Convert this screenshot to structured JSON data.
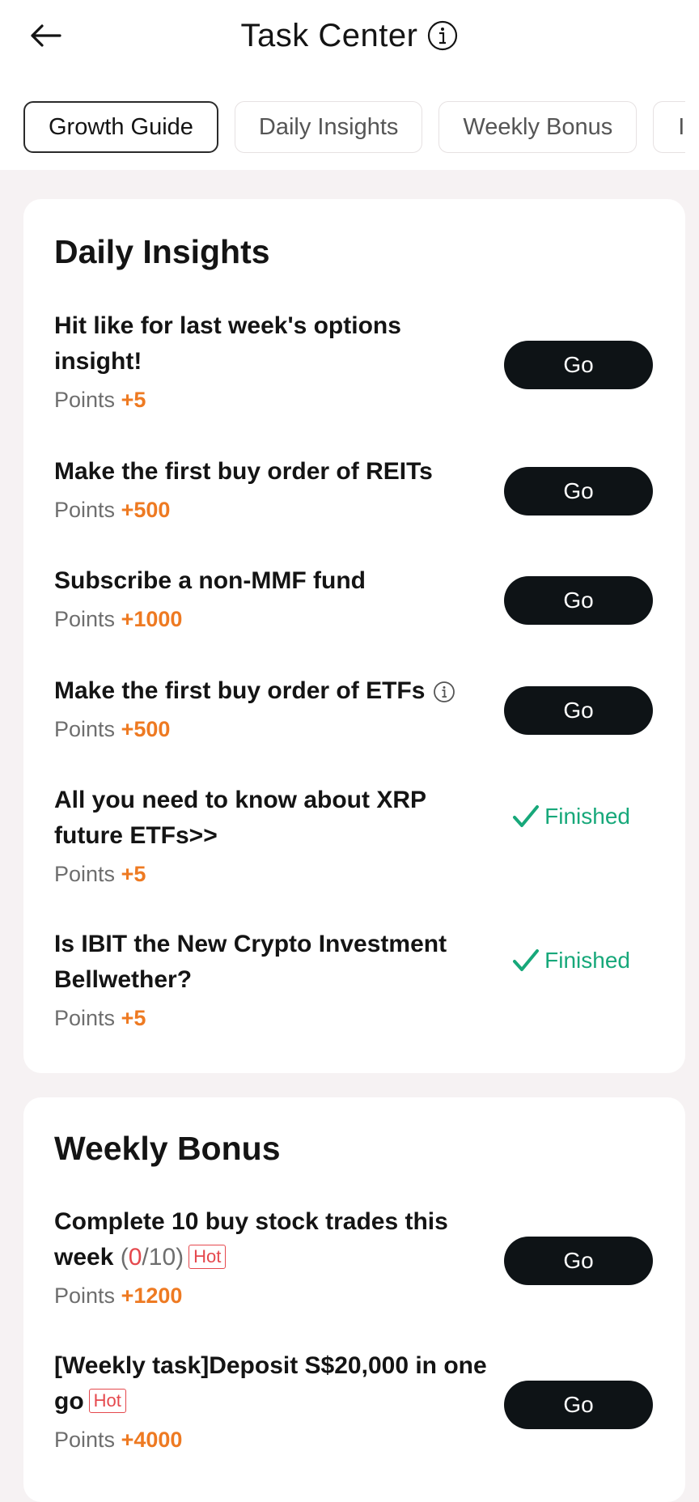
{
  "header": {
    "title": "Task Center"
  },
  "tabs": [
    "Growth Guide",
    "Daily Insights",
    "Weekly Bonus",
    "I"
  ],
  "daily": {
    "title": "Daily Insights",
    "tasks": [
      {
        "title": "Hit like for last week's options insight!",
        "points_label": "Points",
        "points": "+5",
        "action": "Go"
      },
      {
        "title": "Make the first buy order of REITs",
        "points_label": "Points",
        "points": "+500",
        "action": "Go"
      },
      {
        "title": "Subscribe a non-MMF fund",
        "points_label": "Points",
        "points": "+1000",
        "action": "Go"
      },
      {
        "title": "Make the first buy order of ETFs",
        "points_label": "Points",
        "points": "+500",
        "action": "Go"
      },
      {
        "title": "All you need to know about XRP future ETFs>>",
        "points_label": "Points",
        "points": "+5",
        "status": "Finished"
      },
      {
        "title": "Is IBIT the New Crypto Investment Bellwether?",
        "points_label": "Points",
        "points": "+5",
        "status": "Finished"
      }
    ]
  },
  "weekly": {
    "title": "Weekly Bonus",
    "tasks": [
      {
        "title": "Complete 10 buy stock trades this week",
        "progress_open": "(",
        "progress_current": "0",
        "progress_total": "/10)",
        "badge": "Hot",
        "points_label": "Points",
        "points": "+1200",
        "action": "Go"
      },
      {
        "title": "[Weekly task]Deposit S$20,000 in one go",
        "badge": "Hot",
        "points_label": "Points",
        "points": "+4000",
        "action": "Go"
      }
    ]
  },
  "colors": {
    "accent_points": "#ee7a22",
    "finished": "#17a87a",
    "hot": "#e5484d",
    "button": "#0e1316"
  }
}
